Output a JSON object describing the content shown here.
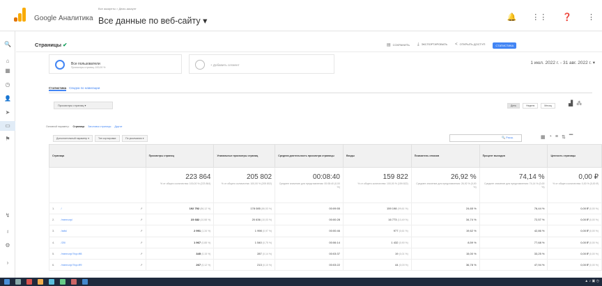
{
  "header": {
    "brand": "Google Аналитика",
    "account_path": "Все аккаунты > Демо-аккаунт",
    "property": "Все данные по веб-сайту",
    "icons": [
      "bell-icon",
      "apps-icon",
      "help-icon",
      "more-icon"
    ]
  },
  "page": {
    "title": "Страницы",
    "actions": [
      "СОХРАНИТЬ",
      "ЭКСПОРТИРОВАТЬ",
      "ОТКРЫТЬ ДОСТУП",
      "СТАТИСТИКА"
    ]
  },
  "segment": {
    "name": "Все пользователи",
    "subtitle": "Просмотры страниц: 100,00 %",
    "add_label": "+ Добавить сегмент"
  },
  "date_range": "1 июл. 2022 г. - 31 авг. 2022 г.",
  "tabs": [
    "Статистика",
    "Сводка по навигации"
  ],
  "metric_selector": "Просмотры страниц",
  "periods": [
    "День",
    "Неделя",
    "Месяц"
  ],
  "primary_dimension": {
    "label": "Основной параметр:",
    "options": [
      "Страница",
      "Заголовок страницы",
      "Другое"
    ]
  },
  "controls": {
    "secondary_dim": "Дополнительный параметр",
    "sort_type": "Тип сортировки:",
    "sort_value": "По умолчанию",
    "search_btn": "Расш."
  },
  "table": {
    "columns": [
      "Страница",
      "Просмотры страниц",
      "Уникальные просмотры страниц",
      "Средняя длительность просмотра страницы",
      "Входы",
      "Показатель отказов",
      "Процент выходов",
      "Ценность страницы"
    ],
    "totals": [
      {
        "value": "223 864",
        "sub": "% от общего количества: 100,00 % (223 864)"
      },
      {
        "value": "205 802",
        "sub": "% от общего количества: 100,00 % (205 802)"
      },
      {
        "value": "00:08:40",
        "sub": "Среднее значение для представления: 00:08:40 (0,00 %)"
      },
      {
        "value": "159 822",
        "sub": "% от общего количества: 100,00 % (159 822)"
      },
      {
        "value": "26,92 %",
        "sub": "Среднее значение для представления: 26,92 % (0,00 %)"
      },
      {
        "value": "74,14 %",
        "sub": "Среднее значение для представления: 74,14 % (0,00 %)"
      },
      {
        "value": "0,00 ₽",
        "sub": "% от общего количества: 0,00 % (0,00 ₽)"
      }
    ],
    "rows": [
      {
        "n": "1.",
        "page": "/",
        "pv": "192 792",
        "pvp": "(86,12 %)",
        "upv": "178 085",
        "upvp": "(86,53 %)",
        "avg": "00:09:55",
        "ent": "159 198",
        "entp": "(99,61 %)",
        "bounce": "24,65 %",
        "exit": "76,44 %",
        "val": "0,00 ₽",
        "valp": "(0,00 %)"
      },
      {
        "n": "2.",
        "page": "/memory/",
        "pv": "23 682",
        "pvp": "(10,58 %)",
        "upv": "20 636",
        "upvp": "(10,03 %)",
        "avg": "00:00:28",
        "ent": "16 773",
        "entp": "(10,49 %)",
        "bounce": "34,74 %",
        "exit": "72,57 %",
        "val": "0,00 ₽",
        "valp": "(0,00 %)"
      },
      {
        "n": "3.",
        "page": "/ads/",
        "pv": "2 991",
        "pvp": "(1,34 %)",
        "upv": "1 998",
        "upvp": "(0,97 %)",
        "avg": "00:00:46",
        "ent": "977",
        "entp": "(0,61 %)",
        "bounce": "19,62 %",
        "exit": "42,86 %",
        "val": "0,00 ₽",
        "valp": "(0,00 %)"
      },
      {
        "n": "4.",
        "page": "/20/",
        "pv": "1 967",
        "pvp": "(0,88 %)",
        "upv": "1 540",
        "upvp": "(0,75 %)",
        "avg": "00:06:14",
        "ent": "1 432",
        "entp": "(0,90 %)",
        "bounce": "8,59 %",
        "exit": "77,68 %",
        "val": "0,00 ₽",
        "valp": "(0,00 %)"
      },
      {
        "n": "5.",
        "page": "/memory/?bp=ff8",
        "pv": "345",
        "pvp": "(0,15 %)",
        "upv": "287",
        "upvp": "(0,14 %)",
        "avg": "00:03:37",
        "ent": "19",
        "entp": "(0,01 %)",
        "bounce": "15,00 %",
        "exit": "33,25 %",
        "val": "0,00 ₽",
        "valp": "(0,00 %)"
      },
      {
        "n": "6.",
        "page": "/memory/?bp=ff9",
        "pv": "267",
        "pvp": "(0,12 %)",
        "upv": "213",
        "upvp": "(0,10 %)",
        "avg": "00:03:22",
        "ent": "44",
        "entp": "(0,03 %)",
        "bounce": "36,78 %",
        "exit": "47,94 %",
        "val": "0,00 ₽",
        "valp": "(0,00 %)"
      }
    ]
  },
  "colors": {
    "accent": "#4285f4",
    "logo_orange": "#f9ab00",
    "logo_dark": "#e37400",
    "ok_green": "#0f9d58"
  }
}
